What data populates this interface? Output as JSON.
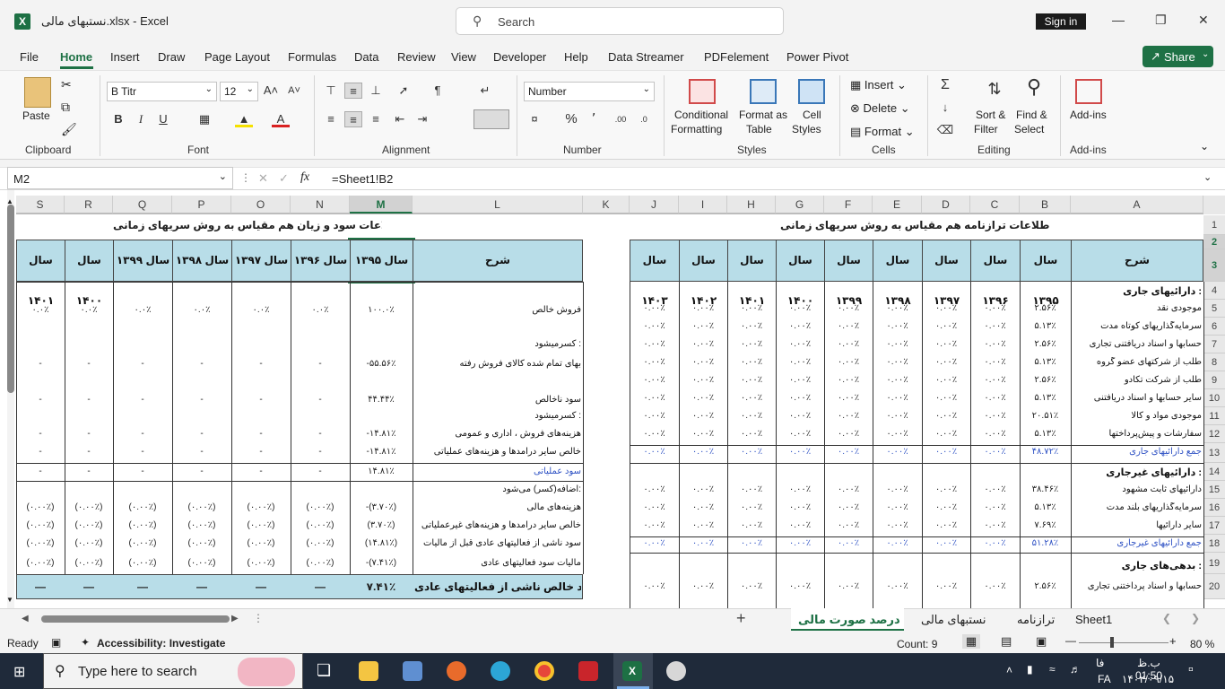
{
  "titlebar": {
    "title": "نستبهای مالی.xlsx  -  Excel",
    "search_placeholder": "Search",
    "sign_in": "Sign in"
  },
  "menu": [
    "File",
    "Home",
    "Insert",
    "Draw",
    "Page Layout",
    "Formulas",
    "Data",
    "Review",
    "View",
    "Developer",
    "Help",
    "Data Streamer",
    "PDFelement",
    "Power Pivot"
  ],
  "share": "Share",
  "ribbon": {
    "clipboard": "Clipboard",
    "paste": "Paste",
    "font_group": "Font",
    "font_name": "B Titr",
    "font_size": "12",
    "alignment": "Alignment",
    "number_group": "Number",
    "number_format": "Number",
    "styles": "Styles",
    "conditional": "Conditional",
    "formatting": "Formatting",
    "format_as": "Format as",
    "table": "Table",
    "cell": "Cell",
    "styles_btn": "Styles",
    "cells": "Cells",
    "insert": "Insert",
    "delete": "Delete",
    "format": "Format",
    "editing": "Editing",
    "sort_filter1": "Sort &",
    "sort_filter2": "Filter",
    "find1": "Find &",
    "find2": "Select",
    "addins": "Add-ins",
    "addins_btn": "Add-ins"
  },
  "formula": {
    "namebox": "M2",
    "fx": "fx",
    "content": "=Sheet1!B2"
  },
  "columns_left": [
    "S",
    "R",
    "Q",
    "P",
    "O",
    "N",
    "M",
    "L",
    "K"
  ],
  "columns_right": [
    "J",
    "I",
    "H",
    "G",
    "F",
    "E",
    "D",
    "C",
    "B",
    "A"
  ],
  "rows": [
    "1",
    "2",
    "3",
    "4",
    "5",
    "6",
    "7",
    "8",
    "9",
    "10",
    "11",
    "12",
    "13",
    "14",
    "15",
    "16",
    "17",
    "18",
    "19",
    "20"
  ],
  "left_table": {
    "title": "اطلاعات سود و زیان هم مقیاس به روش سریهای زمانی",
    "desc_header": "شرح",
    "years": [
      "سال ۱۳۹۵",
      "سال ۱۳۹۶",
      "سال ۱۳۹۷",
      "سال ۱۳۹۸",
      "سال ۱۳۹۹",
      "سال ۱۴۰۰",
      "سال ۱۴۰۱"
    ],
    "rows": [
      {
        "label": "فروش خالص",
        "vals": [
          "۱۰۰.۰٪",
          "۰.۰٪",
          "۰.۰٪",
          "۰.۰٪",
          "۰.۰٪",
          "۰.۰٪",
          "۰.۰٪"
        ]
      },
      {
        "label": "کسرمیشود :",
        "vals": [
          "",
          "",
          "",
          "",
          "",
          "",
          ""
        ]
      },
      {
        "label": "بهای تمام شده کالای فروش رفته",
        "vals": [
          "-۵۵.۵۶٪",
          "-",
          "-",
          "-",
          "-",
          "-",
          "-"
        ]
      },
      {
        "label": "سود ناخالص",
        "vals": [
          "۴۴.۴۴٪",
          "-",
          "-",
          "-",
          "-",
          "-",
          "-"
        ]
      },
      {
        "label": "کسرمیشود :",
        "vals": [
          "",
          "",
          "",
          "",
          "",
          "",
          ""
        ]
      },
      {
        "label": "هزینه‌های فروش ، اداری و عمومی",
        "vals": [
          "-۱۴.۸۱٪",
          "-",
          "-",
          "-",
          "-",
          "-",
          "-"
        ]
      },
      {
        "label": "خالص سایر درآمدها و هزینه‌های عملیاتی",
        "vals": [
          "-۱۴.۸۱٪",
          "-",
          "-",
          "-",
          "-",
          "-",
          "-"
        ]
      },
      {
        "label": "سود عملیاتی",
        "vals": [
          "۱۴.۸۱٪",
          "-",
          "-",
          "-",
          "-",
          "-",
          "-"
        ]
      },
      {
        "label": "اضافه(کسر) می‌شود:",
        "vals": [
          "",
          "",
          "",
          "",
          "",
          "",
          ""
        ]
      },
      {
        "label": "هزینه‌های مالی",
        "vals": [
          "-(۳.۷۰٪)",
          "(۰.۰۰٪)",
          "(۰.۰۰٪)",
          "(۰.۰۰٪)",
          "(۰.۰۰٪)",
          "(۰.۰۰٪)",
          "(۰.۰۰٪)"
        ]
      },
      {
        "label": "خالص سایر درآمدها و هزینه‌های غیرعملیاتی",
        "vals": [
          "(۳.۷۰٪)",
          "(۰.۰۰٪)",
          "(۰.۰۰٪)",
          "(۰.۰۰٪)",
          "(۰.۰۰٪)",
          "(۰.۰۰٪)",
          "(۰.۰۰٪)"
        ]
      },
      {
        "label": "سود ناشی از فعالیتهای عادی قبل از مالیات",
        "vals": [
          "(۱۴.۸۱٪)",
          "(۰.۰۰٪)",
          "(۰.۰۰٪)",
          "(۰.۰۰٪)",
          "(۰.۰۰٪)",
          "(۰.۰۰٪)",
          "(۰.۰۰٪)"
        ]
      },
      {
        "label": "مالیات سود فعالیتهای عادی",
        "vals": [
          "-(۷.۴۱٪)",
          "(۰.۰۰٪)",
          "(۰.۰۰٪)",
          "(۰.۰۰٪)",
          "(۰.۰۰٪)",
          "(۰.۰۰٪)",
          "(۰.۰۰٪)"
        ]
      }
    ],
    "total": {
      "label": "سود خالص ناشی از فعالیتهای عادی",
      "vals": [
        "۷.۴۱٪",
        "—",
        "—",
        "—",
        "—",
        "—",
        "—"
      ]
    }
  },
  "right_table": {
    "title": "اطلاعات ترازنامه هم مقیاس به روش سریهای زمانی",
    "desc_header": "شرح",
    "years": [
      "سال ۱۳۹۵",
      "سال ۱۳۹۶",
      "سال ۱۳۹۷",
      "سال ۱۳۹۸",
      "سال ۱۳۹۹",
      "سال ۱۴۰۰",
      "سال ۱۴۰۱",
      "سال ۱۴۰۲",
      "سال ۱۴۰۳"
    ],
    "rows": [
      {
        "label": "دارائیهای جاری :",
        "vals": [
          "",
          "",
          "",
          "",
          "",
          "",
          "",
          "",
          ""
        ]
      },
      {
        "label": "موجودی نقد",
        "vals": [
          "۲.۵۶٪",
          "۰.۰۰٪",
          "۰.۰۰٪",
          "۰.۰۰٪",
          "۰.۰۰٪",
          "۰.۰۰٪",
          "۰.۰۰٪",
          "۰.۰۰٪",
          "۰.۰۰٪"
        ]
      },
      {
        "label": "سرمایه‌گذاریهای کوتاه مدت",
        "vals": [
          "۵.۱۳٪",
          "۰.۰۰٪",
          "۰.۰۰٪",
          "۰.۰۰٪",
          "۰.۰۰٪",
          "۰.۰۰٪",
          "۰.۰۰٪",
          "۰.۰۰٪",
          "۰.۰۰٪"
        ]
      },
      {
        "label": "حسابها و اسناد دریافتنی تجاری",
        "vals": [
          "۲.۵۶٪",
          "۰.۰۰٪",
          "۰.۰۰٪",
          "۰.۰۰٪",
          "۰.۰۰٪",
          "۰.۰۰٪",
          "۰.۰۰٪",
          "۰.۰۰٪",
          "۰.۰۰٪"
        ]
      },
      {
        "label": "طلب از شرکتهای عضو گروه",
        "vals": [
          "۵.۱۳٪",
          "۰.۰۰٪",
          "۰.۰۰٪",
          "۰.۰۰٪",
          "۰.۰۰٪",
          "۰.۰۰٪",
          "۰.۰۰٪",
          "۰.۰۰٪",
          "۰.۰۰٪"
        ]
      },
      {
        "label": "طلب از شرکت تکادو",
        "vals": [
          "۲.۵۶٪",
          "۰.۰۰٪",
          "۰.۰۰٪",
          "۰.۰۰٪",
          "۰.۰۰٪",
          "۰.۰۰٪",
          "۰.۰۰٪",
          "۰.۰۰٪",
          "۰.۰۰٪"
        ]
      },
      {
        "label": "سایر حسابها و اسناد دریافتنی",
        "vals": [
          "۵.۱۳٪",
          "۰.۰۰٪",
          "۰.۰۰٪",
          "۰.۰۰٪",
          "۰.۰۰٪",
          "۰.۰۰٪",
          "۰.۰۰٪",
          "۰.۰۰٪",
          "۰.۰۰٪"
        ]
      },
      {
        "label": "موجودی مواد و کالا",
        "vals": [
          "۲۰.۵۱٪",
          "۰.۰۰٪",
          "۰.۰۰٪",
          "۰.۰۰٪",
          "۰.۰۰٪",
          "۰.۰۰٪",
          "۰.۰۰٪",
          "۰.۰۰٪",
          "۰.۰۰٪"
        ]
      },
      {
        "label": "سفارشات و پیش‌پرداختها",
        "vals": [
          "۵.۱۳٪",
          "۰.۰۰٪",
          "۰.۰۰٪",
          "۰.۰۰٪",
          "۰.۰۰٪",
          "۰.۰۰٪",
          "۰.۰۰٪",
          "۰.۰۰٪",
          "۰.۰۰٪"
        ]
      },
      {
        "label": "جمع دارائیهای جاری",
        "vals": [
          "۴۸.۷۲٪",
          "۰.۰۰٪",
          "۰.۰۰٪",
          "۰.۰۰٪",
          "۰.۰۰٪",
          "۰.۰۰٪",
          "۰.۰۰٪",
          "۰.۰۰٪",
          "۰.۰۰٪"
        ],
        "blue": true
      },
      {
        "label": "دارائیهای غیرجاری :",
        "vals": [
          "",
          "",
          "",
          "",
          "",
          "",
          "",
          "",
          ""
        ]
      },
      {
        "label": "دارائیهای ثابت مشهود",
        "vals": [
          "۳۸.۴۶٪",
          "۰.۰۰٪",
          "۰.۰۰٪",
          "۰.۰۰٪",
          "۰.۰۰٪",
          "۰.۰۰٪",
          "۰.۰۰٪",
          "۰.۰۰٪",
          "۰.۰۰٪"
        ]
      },
      {
        "label": "سرمایه‌گذاریهای بلند مدت",
        "vals": [
          "۵.۱۳٪",
          "۰.۰۰٪",
          "۰.۰۰٪",
          "۰.۰۰٪",
          "۰.۰۰٪",
          "۰.۰۰٪",
          "۰.۰۰٪",
          "۰.۰۰٪",
          "۰.۰۰٪"
        ]
      },
      {
        "label": "سایر دارائیها",
        "vals": [
          "۷.۶۹٪",
          "۰.۰۰٪",
          "۰.۰۰٪",
          "۰.۰۰٪",
          "۰.۰۰٪",
          "۰.۰۰٪",
          "۰.۰۰٪",
          "۰.۰۰٪",
          "۰.۰۰٪"
        ]
      },
      {
        "label": "جمع دارائیهای غیرجاری",
        "vals": [
          "۵۱.۲۸٪",
          "۰.۰۰٪",
          "۰.۰۰٪",
          "۰.۰۰٪",
          "۰.۰۰٪",
          "۰.۰۰٪",
          "۰.۰۰٪",
          "۰.۰۰٪",
          "۰.۰۰٪"
        ],
        "blue": true
      },
      {
        "label": "بدهی‌های جاری :",
        "vals": [
          "",
          "",
          "",
          "",
          "",
          "",
          "",
          "",
          ""
        ]
      },
      {
        "label": "حسابها و اسناد پرداختنی تجاری",
        "vals": [
          "۲.۵۶٪",
          "۰.۰۰٪",
          "۰.۰۰٪",
          "۰.۰۰٪",
          "۰.۰۰٪",
          "۰.۰۰٪",
          "۰.۰۰٪",
          "۰.۰۰٪",
          "۰.۰۰٪"
        ]
      }
    ]
  },
  "sheet_tabs": [
    "درصد صورت مالی",
    "نستبهای مالی",
    "ترازنامه",
    "Sheet1"
  ],
  "status": {
    "ready": "Ready",
    "accessibility": "Accessibility: Investigate",
    "count": "Count: 9",
    "zoom": "80 %"
  },
  "taskbar": {
    "search": "Type here to search",
    "time": "ب.ظ 01:50",
    "date": "۱۴۰۲/۰۹/۱۵",
    "lang1": "FA",
    "lang2": "فا"
  }
}
